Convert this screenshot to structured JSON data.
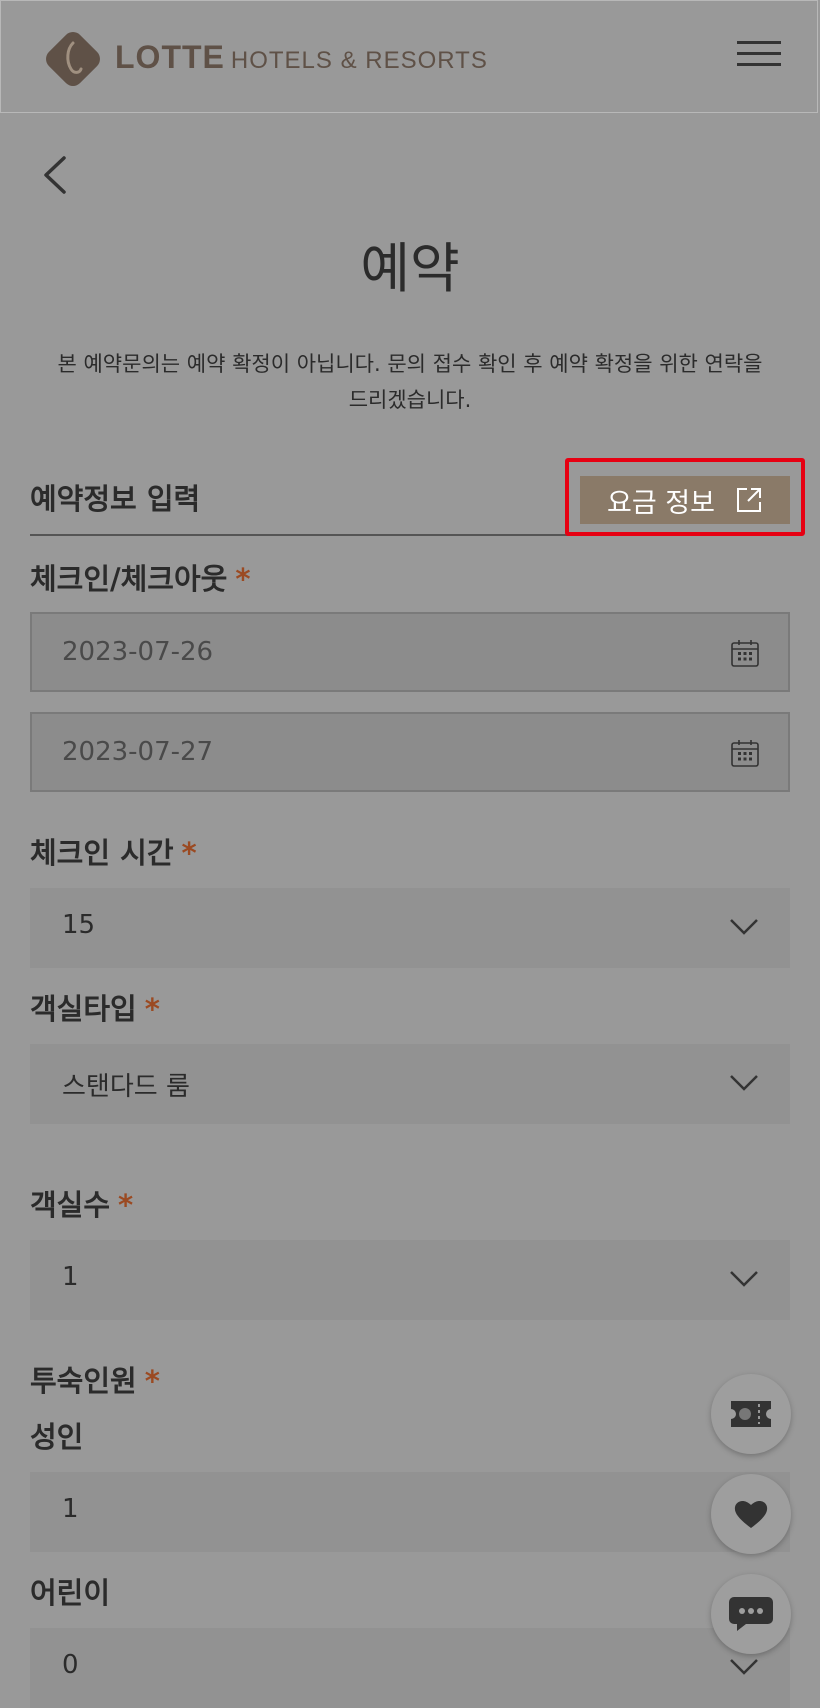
{
  "header": {
    "logo_brand": "LOTTE",
    "logo_sub": "HOTELS & RESORTS"
  },
  "page": {
    "title": "예약",
    "notice": "본 예약문의는 예약 확정이 아닙니다. 문의 접수 확인 후 예약 확정을 위한 연락을 드리겠습니다."
  },
  "section": {
    "title": "예약정보 입력",
    "rate_button": "요금 정보"
  },
  "form": {
    "checkin_checkout": {
      "label": "체크인/체크아웃",
      "required": "*",
      "checkin": "2023-07-26",
      "checkout": "2023-07-27"
    },
    "checkin_time": {
      "label": "체크인 시간",
      "required": "*",
      "value": "15"
    },
    "room_type": {
      "label": "객실타입",
      "required": "*",
      "value": "스탠다드 룸"
    },
    "room_count": {
      "label": "객실수",
      "required": "*",
      "value": "1"
    },
    "guests": {
      "label": "투숙인원",
      "required": "*",
      "adult_label": "성인",
      "adult_value": "1",
      "child_label": "어린이",
      "child_value": "0"
    }
  },
  "icons": [
    "hamburger-menu-icon",
    "back-arrow-icon",
    "external-link-icon",
    "calendar-icon",
    "chevron-down-icon",
    "ticket-icon",
    "heart-icon",
    "chat-icon"
  ],
  "colors": {
    "accent": "#8a7a68",
    "required": "#9b4a22",
    "highlight": "#e60012"
  }
}
